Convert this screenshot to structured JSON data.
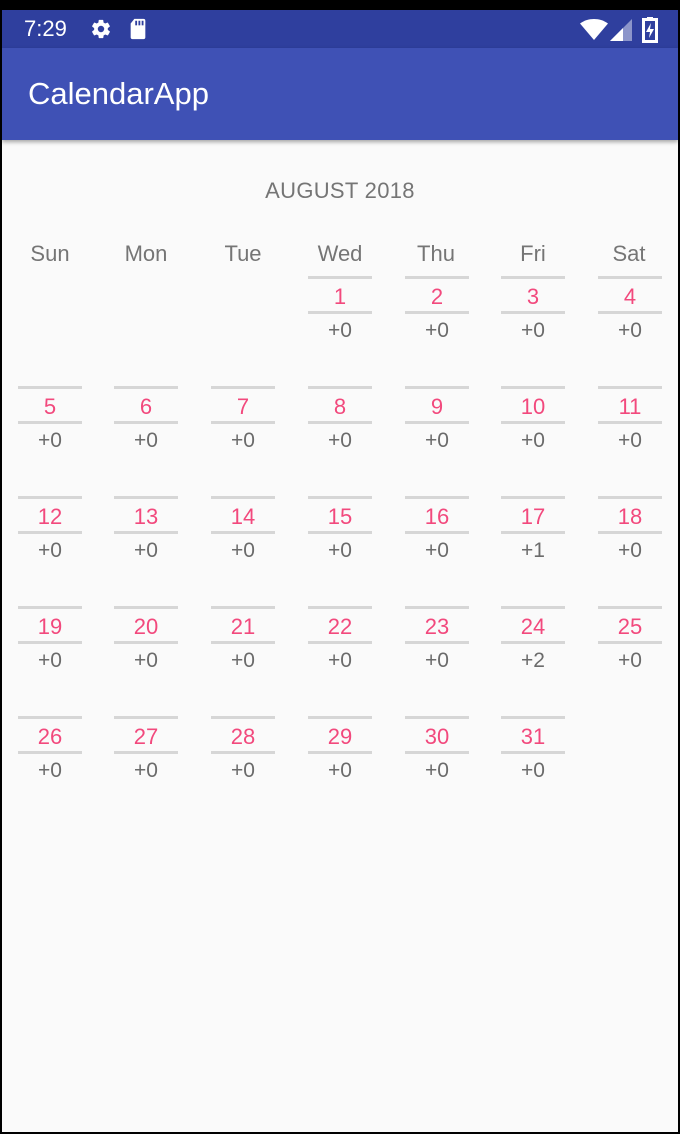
{
  "status_bar": {
    "time": "7:29",
    "icons": [
      "gear-icon",
      "sd-card-icon",
      "wifi-icon",
      "signal-icon",
      "battery-charging-icon"
    ]
  },
  "app_bar": {
    "title": "CalendarApp",
    "color": "#3f51b5"
  },
  "calendar": {
    "month_title": "AUGUST 2018",
    "weekdays": [
      "Sun",
      "Mon",
      "Tue",
      "Wed",
      "Thu",
      "Fri",
      "Sat"
    ],
    "day_color": "#f2497d",
    "days": [
      {
        "day": "1",
        "count": "+0"
      },
      {
        "day": "2",
        "count": "+0"
      },
      {
        "day": "3",
        "count": "+0"
      },
      {
        "day": "4",
        "count": "+0"
      },
      {
        "day": "5",
        "count": "+0"
      },
      {
        "day": "6",
        "count": "+0"
      },
      {
        "day": "7",
        "count": "+0"
      },
      {
        "day": "8",
        "count": "+0"
      },
      {
        "day": "9",
        "count": "+0"
      },
      {
        "day": "10",
        "count": "+0"
      },
      {
        "day": "11",
        "count": "+0"
      },
      {
        "day": "12",
        "count": "+0"
      },
      {
        "day": "13",
        "count": "+0"
      },
      {
        "day": "14",
        "count": "+0"
      },
      {
        "day": "15",
        "count": "+0"
      },
      {
        "day": "16",
        "count": "+0"
      },
      {
        "day": "17",
        "count": "+1"
      },
      {
        "day": "18",
        "count": "+0"
      },
      {
        "day": "19",
        "count": "+0"
      },
      {
        "day": "20",
        "count": "+0"
      },
      {
        "day": "21",
        "count": "+0"
      },
      {
        "day": "22",
        "count": "+0"
      },
      {
        "day": "23",
        "count": "+0"
      },
      {
        "day": "24",
        "count": "+2"
      },
      {
        "day": "25",
        "count": "+0"
      },
      {
        "day": "26",
        "count": "+0"
      },
      {
        "day": "27",
        "count": "+0"
      },
      {
        "day": "28",
        "count": "+0"
      },
      {
        "day": "29",
        "count": "+0"
      },
      {
        "day": "30",
        "count": "+0"
      },
      {
        "day": "31",
        "count": "+0"
      }
    ]
  }
}
